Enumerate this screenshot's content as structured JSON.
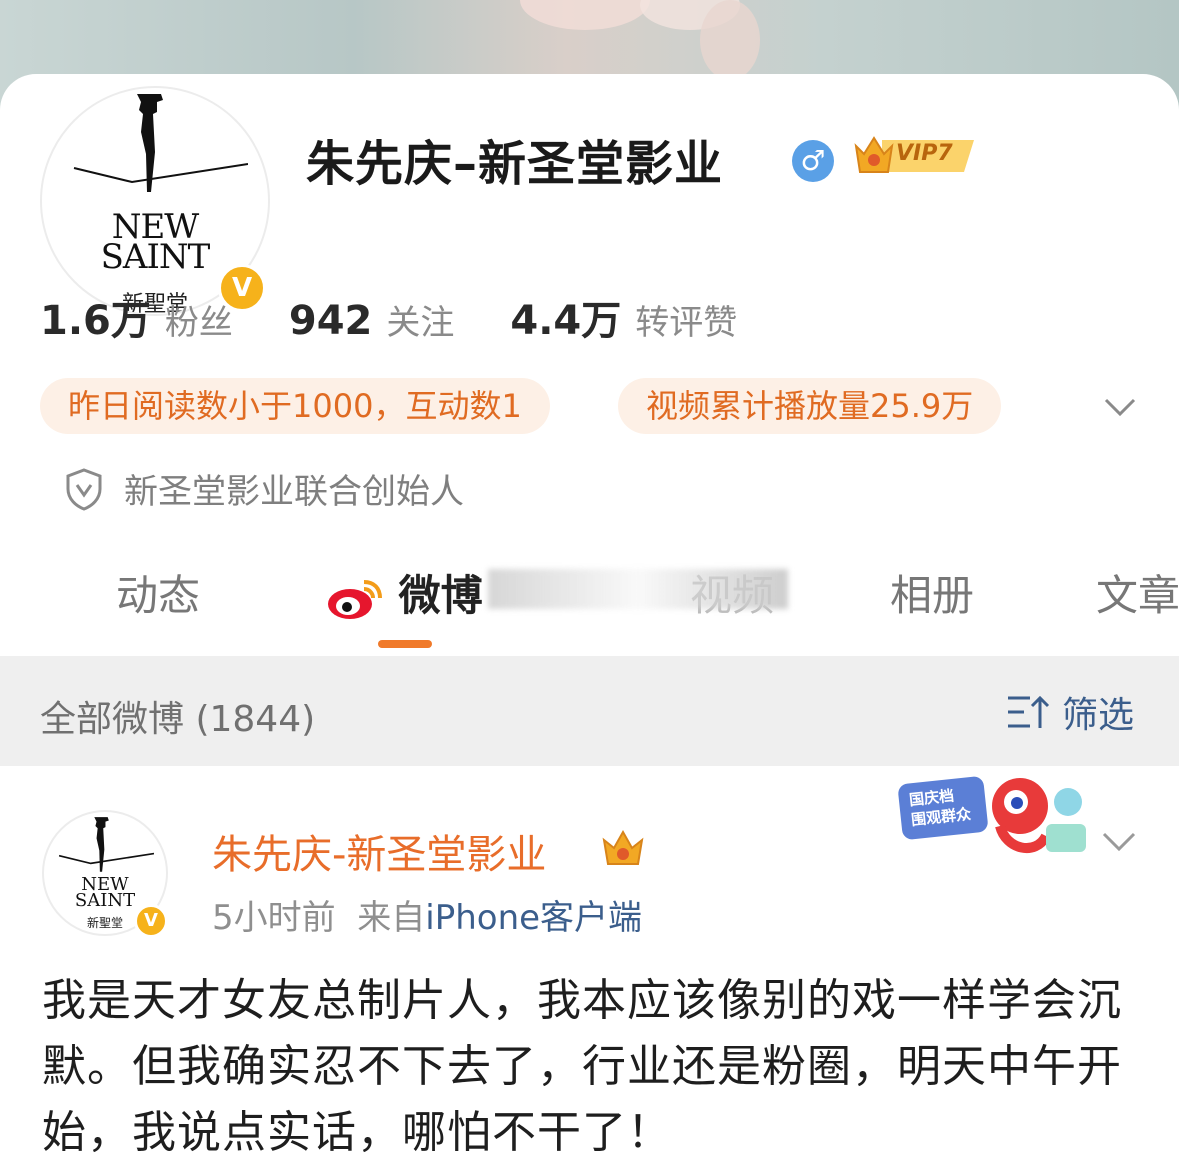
{
  "profile": {
    "name": "朱先庆–新圣堂影业",
    "gender_icon": "♂",
    "vip_label": "VIP7",
    "avatar_logo": {
      "line1": "NEW",
      "line2": "SAINT",
      "sub": "新聖堂"
    },
    "verified_badge": "V",
    "stats": [
      {
        "num": "1.6万",
        "label": "粉丝"
      },
      {
        "num": "942",
        "label": "关注"
      },
      {
        "num": "4.4万",
        "label": "转评赞"
      }
    ],
    "tags": [
      "昨日阅读数小于1000，互动数1",
      "视频累计播放量25.9万"
    ],
    "verification_text": "新圣堂影业联合创始人"
  },
  "tabs": [
    {
      "label": "动态"
    },
    {
      "label": "微博"
    },
    {
      "label": "视频"
    },
    {
      "label": "相册"
    },
    {
      "label": "文章"
    }
  ],
  "filter_bar": {
    "title": "全部微博 (1844)",
    "filter_label": "筛选"
  },
  "post": {
    "author": "朱先庆-新圣堂影业",
    "time": "5小时前",
    "source_prefix": "来自",
    "source": "iPhone客户端",
    "sticker_text": [
      "国庆档",
      "围观群众"
    ],
    "body": "我是天才女友总制片人，我本应该像别的戏一样学会沉默。但我确实忍不下去了，行业还是粉圈，明天中午开始，我说点实话，哪怕不干了！"
  },
  "colors": {
    "accent_orange": "#e86d2a",
    "tag_bg": "#fdf0e6",
    "link_blue": "#3b5e8c",
    "verify_gold": "#f6b21b",
    "gender_blue": "#5aa0e6"
  }
}
